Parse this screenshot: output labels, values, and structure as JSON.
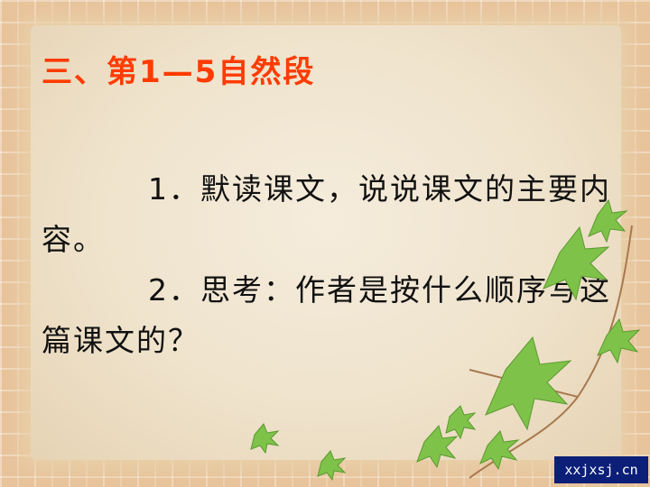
{
  "slide": {
    "title": "三、第1—5自然段",
    "paragraphs": [
      "1．默读课文，说说课文的主要内容。",
      "2．思考：作者是按什么顺序写这篇课文的？"
    ],
    "watermark": "xxjxsj.cn",
    "colors": {
      "title": "#ff3b00",
      "text": "#111111",
      "frame": "#e8c39b",
      "panel": "#f2e8d5",
      "leaf": "#7fc24a"
    },
    "decor_icons": [
      "brick-frame",
      "ivy-leaf-icon"
    ]
  }
}
